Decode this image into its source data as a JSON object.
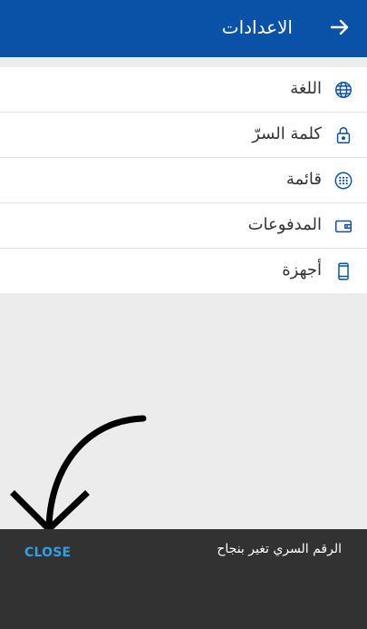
{
  "header": {
    "title": "الاعدادات",
    "back_icon": "arrow-right-icon",
    "background": "#0a52a8"
  },
  "settings": {
    "items": [
      {
        "label": "اللغة",
        "icon": "globe-icon"
      },
      {
        "label": "كلمة السرّ",
        "icon": "lock-icon"
      },
      {
        "label": "قائمة",
        "icon": "grid-dots-icon"
      },
      {
        "label": "المدفوعات",
        "icon": "wallet-icon"
      },
      {
        "label": "أجهزة",
        "icon": "phone-icon"
      }
    ],
    "icon_color": "#0a52a8"
  },
  "snackbar": {
    "message": "الرقم السري تغير بنجاح",
    "action_label": "CLOSE",
    "action_color": "#2f9fe8",
    "background": "#323232"
  },
  "annotation": {
    "icon": "curved-arrow-icon"
  }
}
